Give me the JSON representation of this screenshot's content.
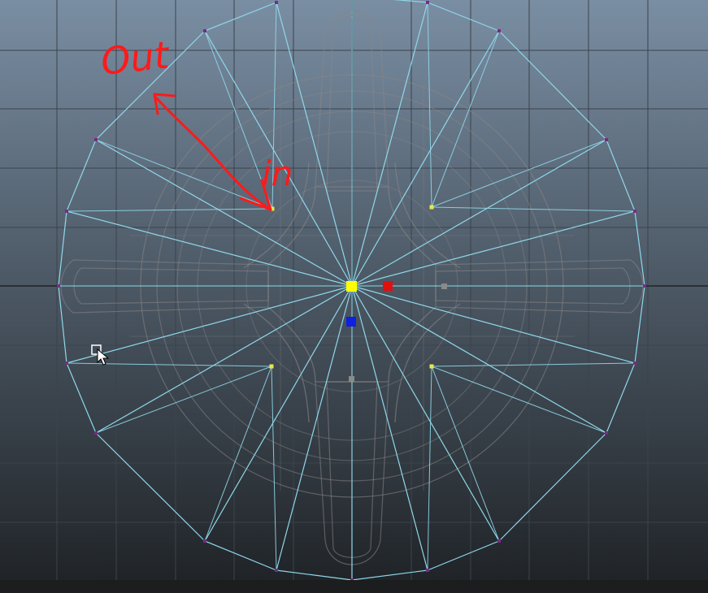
{
  "viewport": {
    "background_top": "#7a8ea3",
    "background_bottom": "#202428",
    "grid_color": "#3b434c",
    "axis_color": "#2b3036"
  },
  "wireframe": {
    "selected_edge_color": "#8fd8ea",
    "base_mesh_color": "#8a8686",
    "vertex_color": "#7a2a8a",
    "selected_vertex_color": "#e8e84a"
  },
  "manipulator": {
    "center_color": "#ffff00",
    "x_handle_color": "#e01010",
    "z_handle_color": "#1020e0",
    "inactive_handle_color": "#8a8a8a"
  },
  "annotations": {
    "out_label": "Out",
    "in_label": "in",
    "color": "#ff1a1a"
  },
  "cursor": {
    "icon": "select-arrow-icon"
  }
}
